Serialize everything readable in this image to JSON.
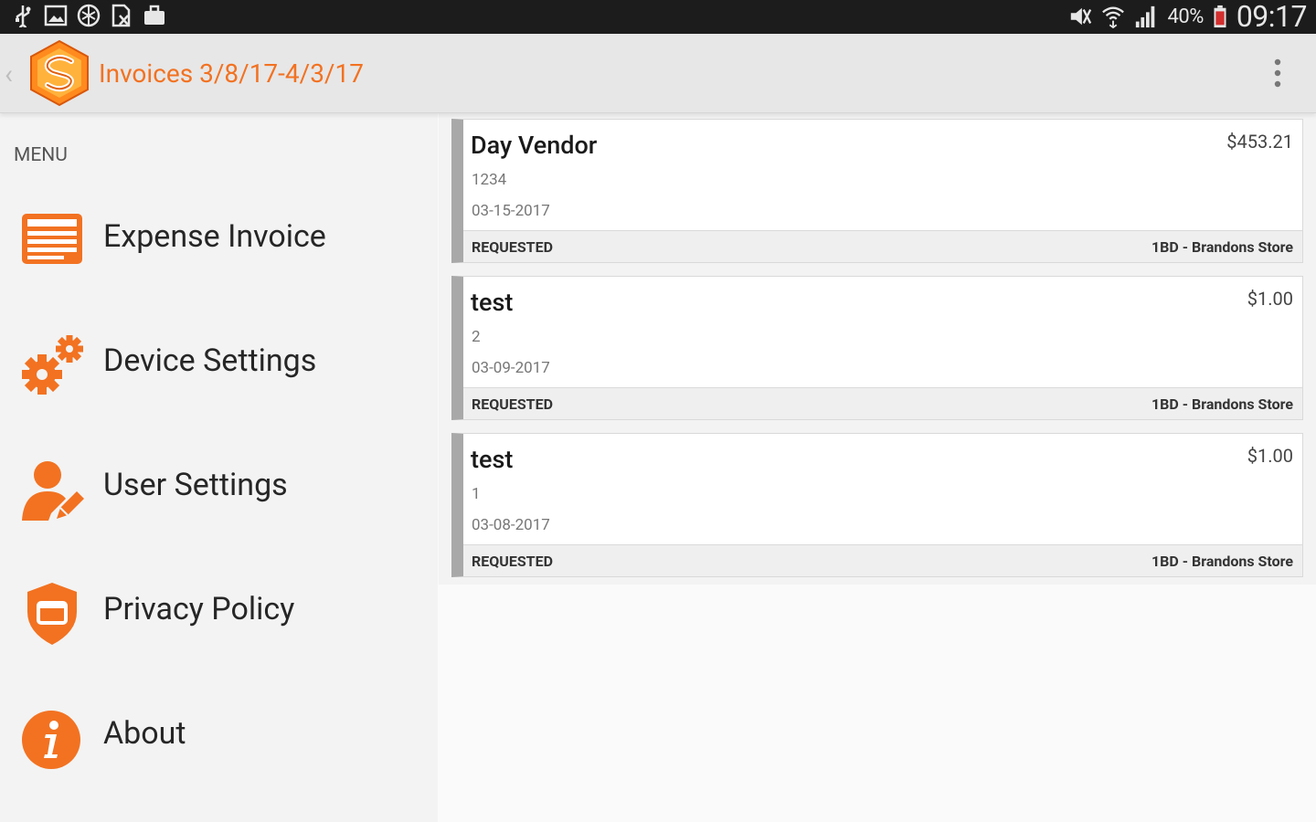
{
  "status_bar": {
    "left_icons": [
      "usb-icon",
      "image-icon",
      "app-icon",
      "document-icon",
      "briefcase-icon"
    ],
    "right_icons": [
      "mute-icon",
      "wifi-icon",
      "signal-icon",
      "battery-icon"
    ],
    "battery_percent": "40%",
    "time": "09:17"
  },
  "action_bar": {
    "back_icon": "chevron-left-icon",
    "logo_icon": "app-logo-icon",
    "title": "Invoices 3/8/17-4/3/17",
    "overflow_icon": "more-vert-icon"
  },
  "drawer": {
    "heading": "MENU",
    "items": [
      {
        "label": "Expense Invoice",
        "icon": "invoice-icon"
      },
      {
        "label": "Device Settings",
        "icon": "gears-icon"
      },
      {
        "label": "User Settings",
        "icon": "user-edit-icon"
      },
      {
        "label": "Privacy Policy",
        "icon": "shield-icon"
      },
      {
        "label": "About",
        "icon": "info-icon"
      }
    ]
  },
  "invoices": [
    {
      "vendor": "Day Vendor",
      "amount": "$453.21",
      "number": "1234",
      "date": "03-15-2017",
      "status": "REQUESTED",
      "store": "1BD - Brandons Store"
    },
    {
      "vendor": "test",
      "amount": "$1.00",
      "number": "2",
      "date": "03-09-2017",
      "status": "REQUESTED",
      "store": "1BD - Brandons Store"
    },
    {
      "vendor": "test",
      "amount": "$1.00",
      "number": "1",
      "date": "03-08-2017",
      "status": "REQUESTED",
      "store": "1BD - Brandons Store"
    }
  ],
  "colors": {
    "accent": "#f27221",
    "status_bar": "#1c1c1c",
    "action_bar": "#e7e7e7",
    "drawer": "#f3f3f3",
    "card_stripe": "#a8a8a8"
  }
}
